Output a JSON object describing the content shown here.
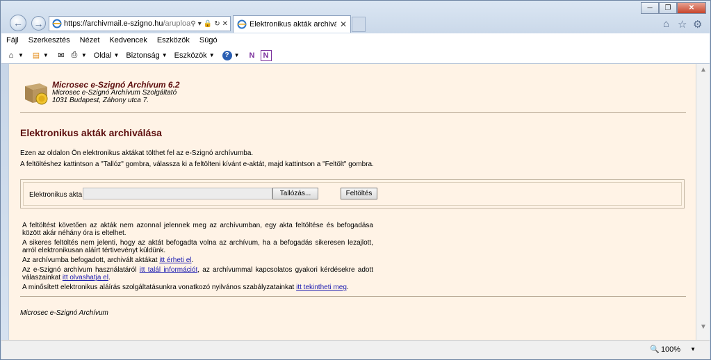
{
  "browser": {
    "url_host": "https://archivmail.e-szigno.hu",
    "url_path": "/arupload",
    "tab_title": "Elektronikus akták archiválá...",
    "zoom": "100%"
  },
  "menu": [
    "Fájl",
    "Szerkesztés",
    "Nézet",
    "Kedvencek",
    "Eszközök",
    "Súgó"
  ],
  "commandbar": {
    "page": "Oldal",
    "safety": "Biztonság",
    "tools": "Eszközök"
  },
  "header": {
    "title": "Microsec e-Szignó Archívum 6.2",
    "line1": "Microsec e-Szignó Archívum Szolgáltató",
    "line2": "1031 Budapest, Záhony utca 7."
  },
  "page": {
    "title": "Elektronikus akták archiválása",
    "intro1": "Ezen az oldalon Ön elektronikus aktákat tölthet fel az e-Szignó archívumba.",
    "intro2": "A feltöltéshez kattintson a \"Tallóz\" gombra, válassza ki a feltölteni kívánt e-aktát, majd kattintson a \"Feltölt\" gombra."
  },
  "form": {
    "label": "Elektronikus akta:",
    "browse": "Tallózás...",
    "upload": "Feltöltés"
  },
  "notes": {
    "n1": "A feltöltést követően az akták nem azonnal jelennek meg az archívumban, egy akta feltöltése és befogadása között akár néhány óra is eltelhet.",
    "n2": "A sikeres feltöltés nem jelenti, hogy az aktát befogadta volna az archívum, ha a befogadás sikeresen lezajlott, arról elektronikusan aláírt tértivevényt küldünk.",
    "n3_pre": "Az archívumba befogadott, archivált aktákat ",
    "n3_link": "itt érheti el",
    "n3_post": ".",
    "n4_pre": "Az e-Szignó archívum használatáról ",
    "n4_link1": "itt talál információt",
    "n4_mid": ", az archívummal kapcsolatos gyakori kérdésekre adott válaszainkat ",
    "n4_link2": "itt olvashatja el",
    "n4_post": ".",
    "n5_pre": "A minősített elektronikus aláírás szolgáltatásunkra vonatkozó nyilvános szabályzatainkat ",
    "n5_link": "itt tekintheti meg",
    "n5_post": "."
  },
  "footer": "Microsec e-Szignó Archívum"
}
